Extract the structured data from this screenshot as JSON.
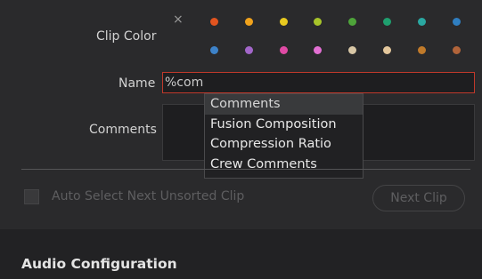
{
  "clip_color": {
    "label": "Clip Color",
    "clear_glyph": "×",
    "swatches": [
      {
        "name": "orange",
        "color": "#e2541f"
      },
      {
        "name": "apricot",
        "color": "#f0a21c"
      },
      {
        "name": "yellow",
        "color": "#e8c91f"
      },
      {
        "name": "lime",
        "color": "#a7c42a"
      },
      {
        "name": "olive",
        "color": "#4ea43a"
      },
      {
        "name": "green",
        "color": "#1f9f6f"
      },
      {
        "name": "teal",
        "color": "#2aa8a2"
      },
      {
        "name": "navy",
        "color": "#2f7ec0"
      },
      {
        "name": "blue",
        "color": "#3d82c9"
      },
      {
        "name": "purple",
        "color": "#a266c9"
      },
      {
        "name": "pink",
        "color": "#e04aa5"
      },
      {
        "name": "violet",
        "color": "#e26fd3"
      },
      {
        "name": "tan",
        "color": "#d8c7a6"
      },
      {
        "name": "beige",
        "color": "#e3c79c"
      },
      {
        "name": "brown",
        "color": "#c07a2a"
      },
      {
        "name": "chocolate",
        "color": "#b1643a"
      }
    ]
  },
  "name_field": {
    "label": "Name",
    "value": "%com"
  },
  "comments_field": {
    "label": "Comments"
  },
  "autocomplete": {
    "items": [
      "Comments",
      "Fusion Composition",
      "Compression Ratio",
      "Crew Comments"
    ],
    "highlighted_index": 0
  },
  "auto_select": {
    "label": "Auto Select Next Unsorted Clip",
    "checked": false
  },
  "next_clip_button": {
    "label": "Next Clip"
  },
  "audio_section": {
    "title": "Audio Configuration"
  }
}
